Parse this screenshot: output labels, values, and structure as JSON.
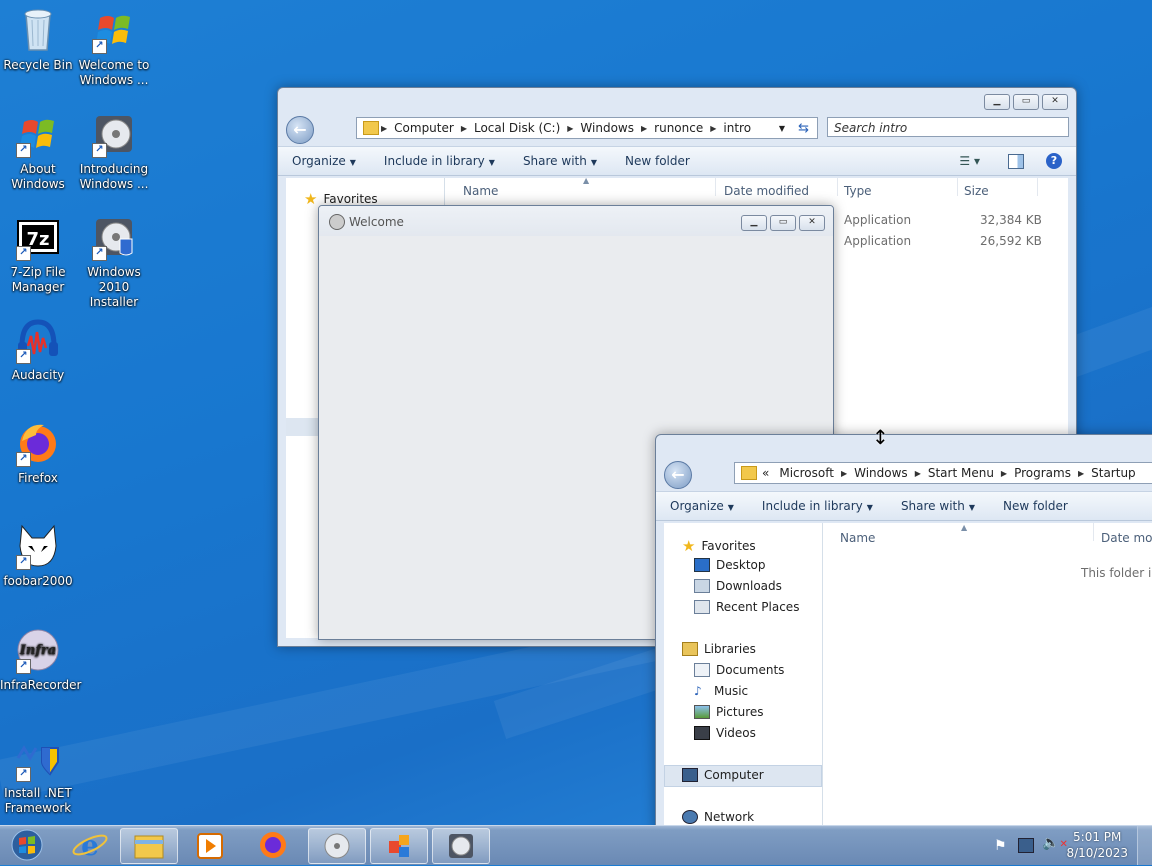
{
  "desktop": {
    "icons": [
      {
        "label": "Recycle Bin",
        "icon": "recycle-bin-icon"
      },
      {
        "label": "Welcome to Windows ...",
        "icon": "windows-flag-icon"
      },
      {
        "label": "About Windows",
        "icon": "windows-flag-icon"
      },
      {
        "label": "Introducing Windows ...",
        "icon": "installer-disc-icon"
      },
      {
        "label": "7-Zip File Manager",
        "icon": "7zip-icon"
      },
      {
        "label": "Windows 2010 Installer",
        "icon": "installer-disc-icon"
      },
      {
        "label": "Audacity",
        "icon": "audacity-icon"
      },
      {
        "label": "Firefox",
        "icon": "firefox-icon"
      },
      {
        "label": "foobar2000",
        "icon": "foobar-icon"
      },
      {
        "label": "InfraRecorder",
        "icon": "infrarecorder-icon"
      },
      {
        "label": "Install .NET Framework",
        "icon": "dotnet-shield-icon"
      }
    ],
    "icon1_line2": "Windows ...",
    "icon1_line1": "Welcome to"
  },
  "explorer1": {
    "breadcrumb": [
      "Computer",
      "Local Disk (C:)",
      "Windows",
      "runonce",
      "intro"
    ],
    "search_placeholder": "Search intro",
    "commands": {
      "organize": "Organize",
      "include": "Include in library",
      "share": "Share with",
      "newfolder": "New folder"
    },
    "nav": {
      "favorites": "Favorites"
    },
    "columns": {
      "name": "Name",
      "date": "Date modified",
      "type": "Type",
      "size": "Size"
    },
    "rows": [
      {
        "type": "Application",
        "size": "32,384 KB"
      },
      {
        "type": "Application",
        "size": "26,592 KB"
      }
    ]
  },
  "welcome": {
    "title": "Welcome"
  },
  "explorer2": {
    "breadcrumb_prefix": "«",
    "breadcrumb": [
      "Microsoft",
      "Windows",
      "Start Menu",
      "Programs",
      "Startup"
    ],
    "commands": {
      "organize": "Organize",
      "include": "Include in library",
      "share": "Share with",
      "newfolder": "New folder"
    },
    "nav": {
      "favorites": "Favorites",
      "desktop": "Desktop",
      "downloads": "Downloads",
      "recent": "Recent Places",
      "libraries": "Libraries",
      "documents": "Documents",
      "music": "Music",
      "pictures": "Pictures",
      "videos": "Videos",
      "computer": "Computer",
      "network": "Network"
    },
    "columns": {
      "name": "Name",
      "date": "Date modif"
    },
    "empty_message": "This folder is"
  },
  "taskbar": {
    "time": "5:01 PM",
    "date": "8/10/2023",
    "buttons": [
      "start-orb",
      "internet-explorer",
      "windows-explorer",
      "media-player",
      "firefox",
      "installer",
      "office",
      "welcome-installer"
    ]
  },
  "colors": {
    "desktop": "#1a77cf",
    "taskbar": "#7f9dc3",
    "accent": "#1e395b"
  }
}
